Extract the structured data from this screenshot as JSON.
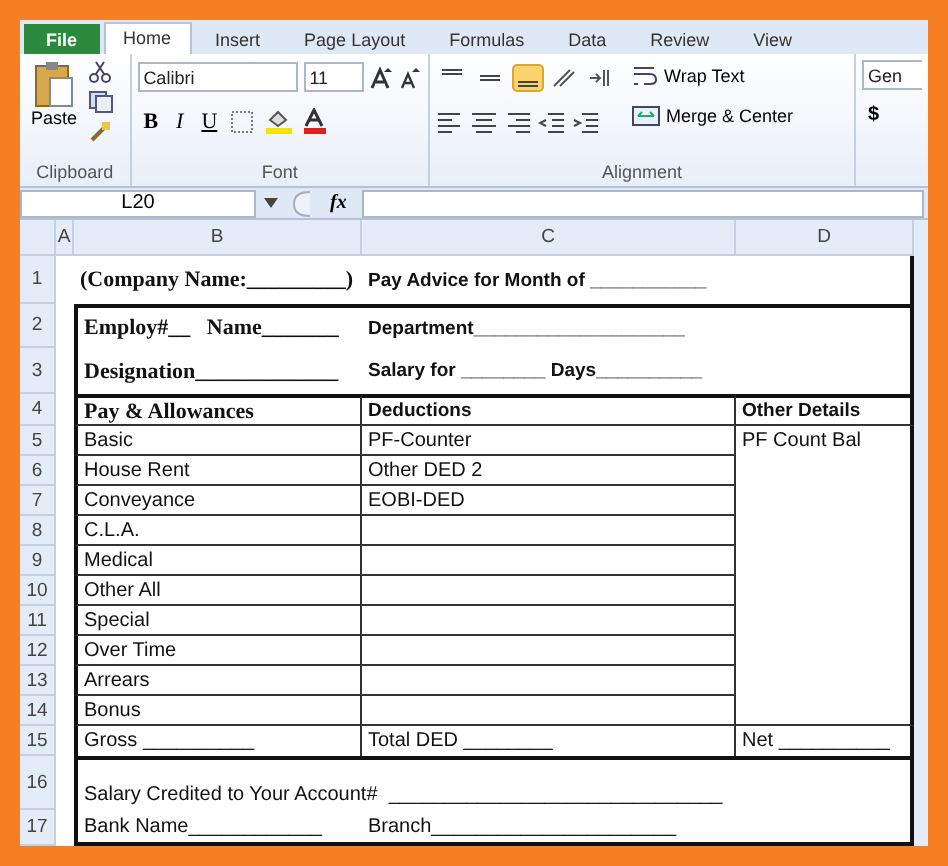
{
  "ribbon_tabs": [
    {
      "label": "File",
      "kind": "file",
      "selected": false
    },
    {
      "label": "Home",
      "kind": "tab",
      "selected": true
    },
    {
      "label": "Insert",
      "kind": "tab",
      "selected": false
    },
    {
      "label": "Page Layout",
      "kind": "tab",
      "selected": false
    },
    {
      "label": "Formulas",
      "kind": "tab",
      "selected": false
    },
    {
      "label": "Data",
      "kind": "tab",
      "selected": false
    },
    {
      "label": "Review",
      "kind": "tab",
      "selected": false
    },
    {
      "label": "View",
      "kind": "tab",
      "selected": false
    }
  ],
  "clipboard": {
    "paste": "Paste",
    "label": "Clipboard"
  },
  "font": {
    "name": "Calibri",
    "size": "11",
    "bold": "B",
    "italic": "I",
    "underline": "U",
    "label": "Font"
  },
  "alignment": {
    "vertical_buttons": [
      {
        "selected": false
      },
      {
        "selected": false
      },
      {
        "selected": true
      }
    ],
    "wrap_text": "Wrap Text",
    "merge": "Merge & Center",
    "label": "Alignment"
  },
  "number": {
    "format": "Gen",
    "currency": "$"
  },
  "formula_bar": {
    "name_box": "L20",
    "fx": "fx"
  },
  "sheet": {
    "columns": [
      "A",
      "B",
      "C",
      "D"
    ],
    "rows": [
      {
        "number": "1",
        "kind": "title",
        "cells": [
          "(Company Name:_________)",
          "Pay Advice for Month of ___________"
        ]
      },
      {
        "number": "2",
        "kind": "info",
        "cells": [
          "Employ#__   Name_______",
          "Department____________________"
        ]
      },
      {
        "number": "3",
        "kind": "info",
        "cells": [
          "Designation_____________",
          "Salary for ________ Days__________"
        ]
      },
      {
        "number": "4",
        "kind": "table-header",
        "cells": [
          "Pay & Allowances",
          "Deductions",
          "Other Details"
        ]
      },
      {
        "number": "5",
        "kind": "table",
        "cells": [
          "Basic",
          "PF-Counter",
          "PF Count Bal"
        ]
      },
      {
        "number": "6",
        "kind": "table",
        "cells": [
          "House Rent",
          "Other DED 2"
        ]
      },
      {
        "number": "7",
        "kind": "table",
        "cells": [
          "Conveyance",
          "EOBI-DED"
        ]
      },
      {
        "number": "8",
        "kind": "table",
        "cells": [
          "C.L.A."
        ]
      },
      {
        "number": "9",
        "kind": "table",
        "cells": [
          "Medical"
        ]
      },
      {
        "number": "10",
        "kind": "table",
        "cells": [
          "Other All"
        ]
      },
      {
        "number": "11",
        "kind": "table",
        "cells": [
          "Special"
        ]
      },
      {
        "number": "12",
        "kind": "table",
        "cells": [
          "Over Time"
        ]
      },
      {
        "number": "13",
        "kind": "table",
        "cells": [
          "Arrears"
        ]
      },
      {
        "number": "14",
        "kind": "table",
        "cells": [
          "Bonus"
        ]
      },
      {
        "number": "15",
        "kind": "table",
        "cells": [
          "Gross __________",
          "Total DED ________",
          "Net __________"
        ]
      },
      {
        "number": "16",
        "kind": "footer",
        "cells": [
          "Salary Credited to Your Account#  ______________________________"
        ]
      },
      {
        "number": "17",
        "kind": "footer",
        "cells": [
          "Bank Name____________",
          "Branch______________________"
        ]
      }
    ]
  }
}
